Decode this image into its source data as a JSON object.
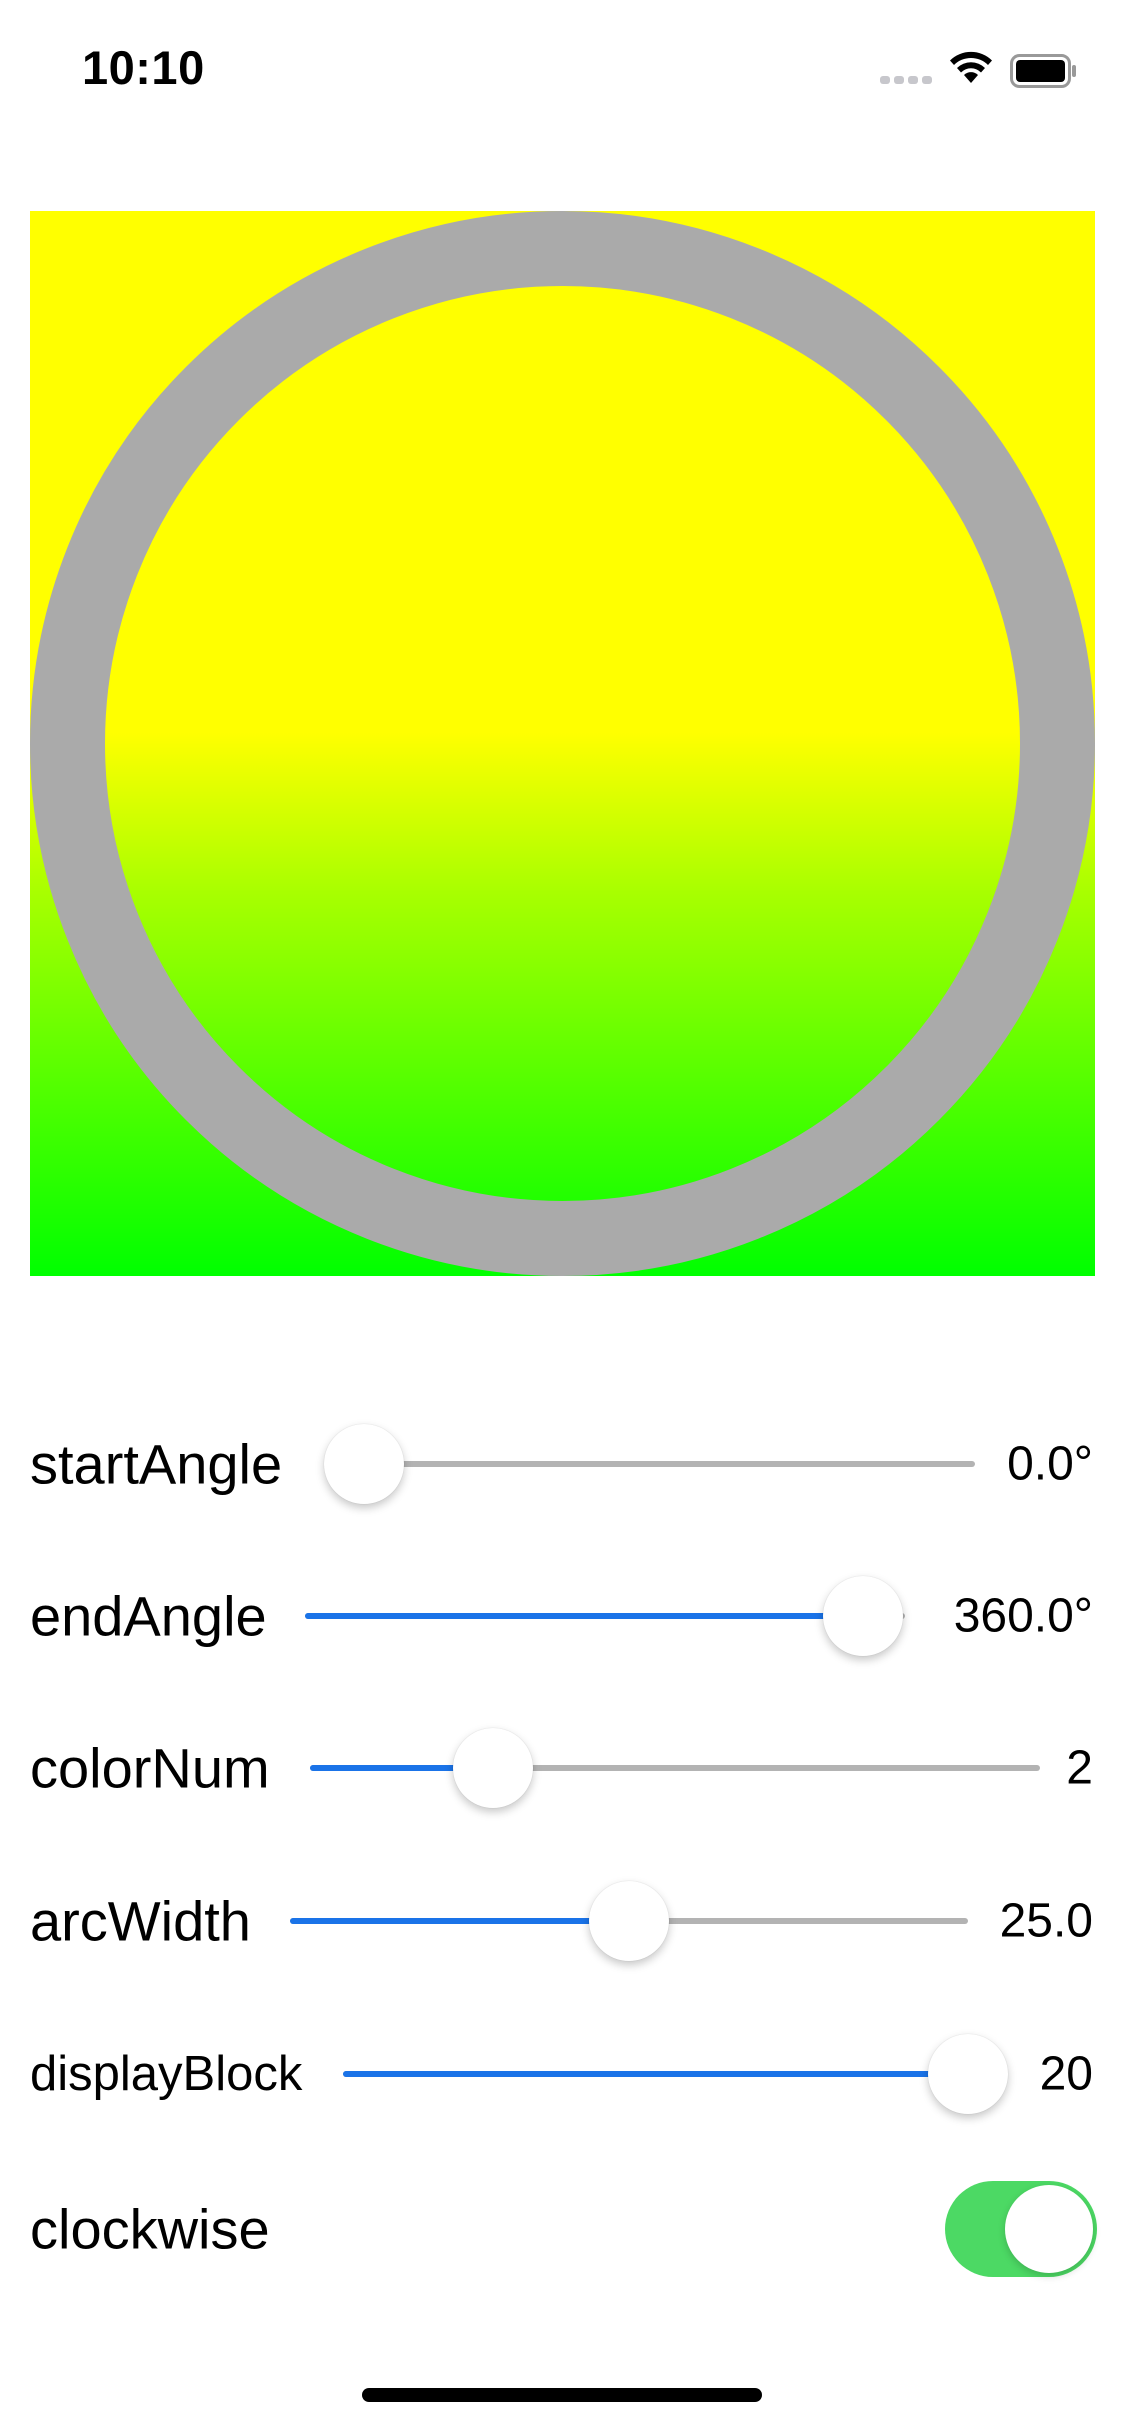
{
  "status_bar": {
    "time": "10:10",
    "signal_icon": "cellular-signal-icon",
    "wifi_icon": "wifi-icon",
    "battery_icon": "battery-icon"
  },
  "canvas": {
    "gradient_colors": [
      "#ffff00",
      "#00ff00"
    ],
    "ring_color": "#aaaaaa"
  },
  "controls": {
    "start_angle": {
      "label": "startAngle",
      "value_text": "0.0°",
      "fraction": 0.06
    },
    "end_angle": {
      "label": "endAngle",
      "value_text": "360.0°",
      "fraction": 0.93
    },
    "color_num": {
      "label": "colorNum",
      "value_text": "2",
      "fraction": 0.25
    },
    "arc_width": {
      "label": "arcWidth",
      "value_text": "25.0",
      "fraction": 0.5
    },
    "display_block": {
      "label": "displayBlock",
      "value_text": "20",
      "fraction": 1.0
    },
    "clockwise": {
      "label": "clockwise",
      "on": true
    }
  },
  "colors": {
    "accent": "#1a73e8",
    "toggle_on": "#4cd964",
    "track": "#b3b3b3"
  }
}
